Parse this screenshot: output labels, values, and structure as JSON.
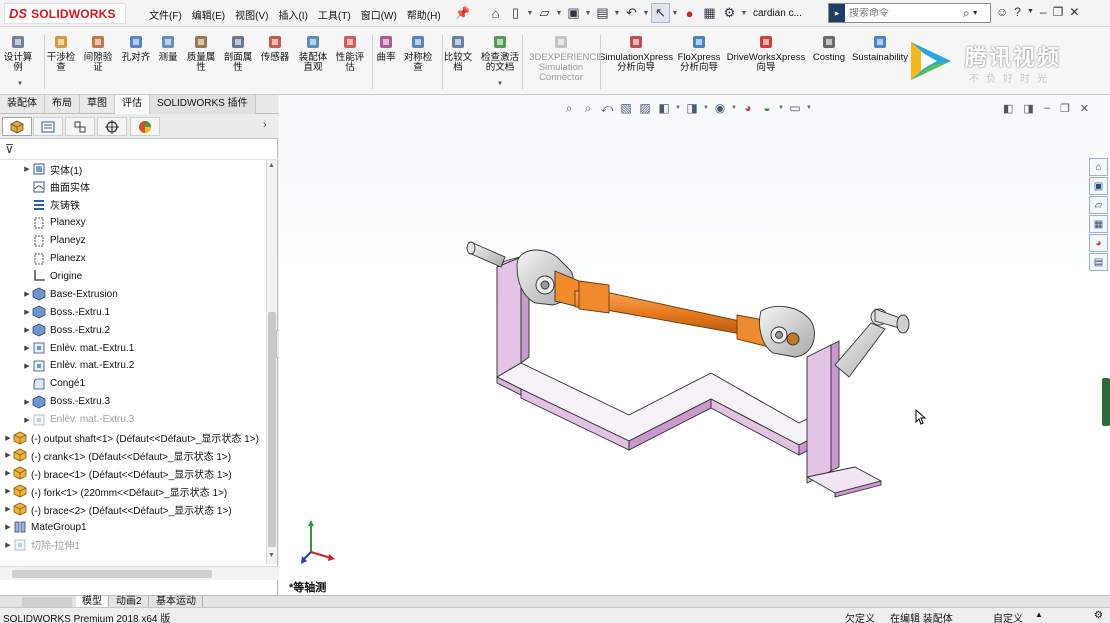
{
  "app": {
    "logo_prefix": "DS",
    "logo_word": "SOLIDWORKS"
  },
  "menu": [
    "文件(F)",
    "编辑(E)",
    "视图(V)",
    "插入(I)",
    "工具(T)",
    "窗口(W)",
    "帮助(H)"
  ],
  "document_name": "cardian c...",
  "search": {
    "placeholder": "搜索命令"
  },
  "commands": [
    {
      "label": "设计算\n例",
      "icon": "design-study-icon"
    },
    {
      "label": "干涉检\n查",
      "icon": "interference-icon"
    },
    {
      "label": "间隙验\n证",
      "icon": "clearance-icon"
    },
    {
      "label": "孔对齐",
      "icon": "hole-align-icon"
    },
    {
      "label": "测量",
      "icon": "measure-icon"
    },
    {
      "label": "质量属\n性",
      "icon": "mass-properties-icon"
    },
    {
      "label": "剖面属\n性",
      "icon": "section-properties-icon"
    },
    {
      "label": "传感器",
      "icon": "sensor-icon"
    },
    {
      "label": "装配体\n直观",
      "icon": "assembly-visualization-icon"
    },
    {
      "label": "性能评\n估",
      "icon": "performance-icon"
    },
    {
      "label": "曲率",
      "icon": "curvature-icon"
    },
    {
      "label": "对称检\n查",
      "icon": "symmetry-icon"
    },
    {
      "label": "比较文\n档",
      "icon": "compare-icon"
    },
    {
      "label": "检查激活\n的文档",
      "icon": "check-active-icon"
    },
    {
      "label": "3DEXPERIENCE\nSimulation\nConnector",
      "icon": "3dx-icon"
    },
    {
      "label": "SimulationXpress\n分析向导",
      "icon": "simxpress-icon"
    },
    {
      "label": "FloXpress\n分析向导",
      "icon": "floxpress-icon"
    },
    {
      "label": "DriveWorksXpress\n向导",
      "icon": "driveworks-icon"
    },
    {
      "label": "Costing",
      "icon": "costing-icon"
    },
    {
      "label": "Sustainability",
      "icon": "sustainability-icon"
    }
  ],
  "watermark": {
    "title": "腾讯视频",
    "subtitle": "不负好时光"
  },
  "tabs": [
    "装配体",
    "布局",
    "草图",
    "评估",
    "SOLIDWORKS 插件"
  ],
  "active_tab": "评估",
  "tree": [
    {
      "label": "实体(1)",
      "icon": "solid-bodies-icon",
      "indent": 1,
      "expander": true
    },
    {
      "label": "曲面实体",
      "icon": "surface-bodies-icon",
      "indent": 1,
      "expander": false
    },
    {
      "label": "灰铸铁",
      "icon": "material-icon",
      "indent": 1,
      "expander": false
    },
    {
      "label": "Planexy",
      "icon": "plane-icon",
      "indent": 1,
      "expander": false
    },
    {
      "label": "Planeyz",
      "icon": "plane-icon",
      "indent": 1,
      "expander": false
    },
    {
      "label": "Planezx",
      "icon": "plane-icon",
      "indent": 1,
      "expander": false
    },
    {
      "label": "Origine",
      "icon": "origin-icon",
      "indent": 1,
      "expander": false
    },
    {
      "label": "Base-Extrusion",
      "icon": "extrude-icon",
      "indent": 1,
      "expander": true
    },
    {
      "label": "Boss.-Extru.1",
      "icon": "extrude-icon",
      "indent": 1,
      "expander": true
    },
    {
      "label": "Boss.-Extru.2",
      "icon": "extrude-icon",
      "indent": 1,
      "expander": true
    },
    {
      "label": "Enlèv. mat.-Extru.1",
      "icon": "cut-extrude-icon",
      "indent": 1,
      "expander": true
    },
    {
      "label": "Enlèv. mat.-Extru.2",
      "icon": "cut-extrude-icon",
      "indent": 1,
      "expander": true
    },
    {
      "label": "Congé1",
      "icon": "fillet-icon",
      "indent": 1,
      "expander": false
    },
    {
      "label": "Boss.-Extru.3",
      "icon": "extrude-icon",
      "indent": 1,
      "expander": true
    },
    {
      "label": "Enlèv. mat.-Extru.3",
      "icon": "cut-extrude-icon",
      "indent": 1,
      "expander": true,
      "dim": true
    },
    {
      "label": "(-) output shaft<1> (Défaut<<Défaut>_显示状态 1>)",
      "icon": "part-icon",
      "indent": 0,
      "expander": true
    },
    {
      "label": "(-) crank<1> (Défaut<<Défaut>_显示状态 1>)",
      "icon": "part-icon",
      "indent": 0,
      "expander": true
    },
    {
      "label": "(-) brace<1> (Défaut<<Défaut>_显示状态 1>)",
      "icon": "part-icon",
      "indent": 0,
      "expander": true
    },
    {
      "label": "(-) fork<1> (220mm<<Défaut>_显示状态 1>)",
      "icon": "part-icon",
      "indent": 0,
      "expander": true
    },
    {
      "label": "(-) brace<2> (Défaut<<Défaut>_显示状态 1>)",
      "icon": "part-icon",
      "indent": 0,
      "expander": true
    },
    {
      "label": "MateGroup1",
      "icon": "mates-icon",
      "indent": 0,
      "expander": true
    },
    {
      "label": "切除-拉伸1",
      "icon": "cut-extrude-icon",
      "indent": 0,
      "expander": true,
      "dim": true
    }
  ],
  "view_label": "*等轴测",
  "bottom_tabs": [
    "模型",
    "动画2",
    "基本运动"
  ],
  "status": {
    "product": "SOLIDWORKS Premium 2018 x64 版",
    "state1": "欠定义",
    "state2": "在编辑 装配体",
    "units": "自定义"
  },
  "colors": {
    "frame": "#d8b0d8",
    "shaft": "#e87a1e",
    "steel": "#c8c8c8",
    "accent": "#d71920"
  }
}
